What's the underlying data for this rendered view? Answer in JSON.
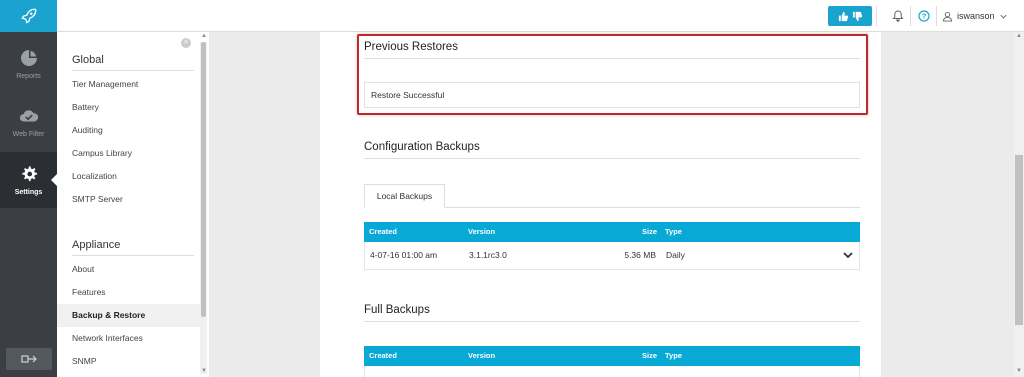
{
  "rail": {
    "items": [
      {
        "label": "Reports",
        "icon": "pie-chart-icon"
      },
      {
        "label": "Web Filter",
        "icon": "cloud-check-icon"
      },
      {
        "label": "Settings",
        "icon": "gear-icon"
      }
    ]
  },
  "topbar": {
    "username": "iswanson"
  },
  "sidebar": {
    "global_heading": "Global",
    "global_items": [
      "Tier Management",
      "Battery",
      "Auditing",
      "Campus Library",
      "Localization",
      "SMTP Server"
    ],
    "appliance_heading": "Appliance",
    "appliance_items": [
      "About",
      "Features",
      "Backup & Restore",
      "Network Interfaces",
      "SNMP"
    ],
    "active_item": "Backup & Restore"
  },
  "main": {
    "previous_restores": {
      "title": "Previous Restores",
      "status": "Restore Successful"
    },
    "config_backups": {
      "title": "Configuration Backups",
      "tab": "Local Backups",
      "columns": [
        "Created",
        "Version",
        "Size",
        "Type"
      ],
      "rows": [
        {
          "created": "4-07-16 01:00 am",
          "version": "3.1.1rc3.0",
          "size": "5.36 MB",
          "type": "Daily"
        }
      ]
    },
    "full_backups": {
      "title": "Full Backups",
      "columns": [
        "Created",
        "Version",
        "Size",
        "Type"
      ]
    }
  },
  "colors": {
    "accent": "#1ba3d0",
    "table_header": "#09a9d6",
    "highlight": "#c0282d",
    "rail_bg": "#3b3f45"
  }
}
